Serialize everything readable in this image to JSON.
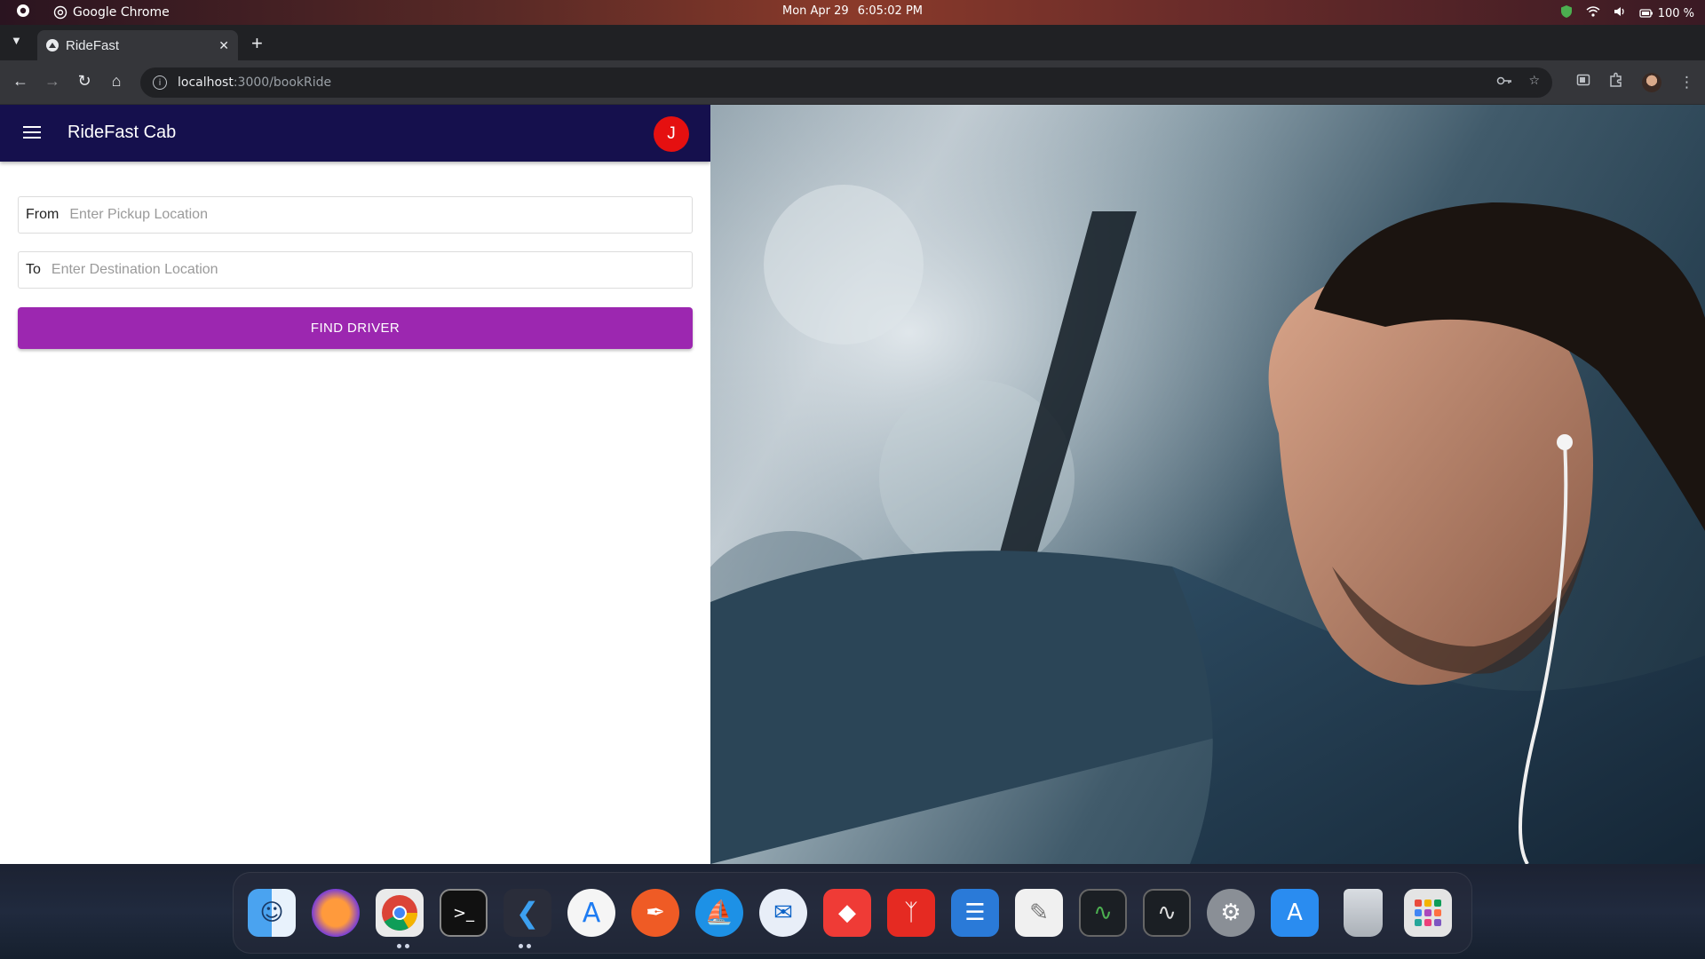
{
  "os_bar": {
    "app_name": "Google Chrome",
    "date": "Mon Apr 29",
    "time": "6:05:02 PM",
    "battery": "100 %"
  },
  "browser": {
    "tab_title": "RideFast",
    "url_host": "localhost",
    "url_path": ":3000/bookRide"
  },
  "app": {
    "title": "RideFast Cab",
    "avatar_initial": "J",
    "from_label": "From",
    "from_placeholder": "Enter Pickup Location",
    "from_value": "",
    "to_label": "To",
    "to_placeholder": "Enter Destination Location",
    "to_value": "",
    "find_driver_label": "FIND DRIVER"
  },
  "colors": {
    "app_bar": "#15104d",
    "button": "#9c27b0",
    "avatar": "#e51010"
  },
  "dock": {
    "icons": [
      "finder-icon",
      "firefox-icon",
      "chrome-icon",
      "terminal-icon",
      "vscode-icon",
      "app-store-icon",
      "postman-icon",
      "docker-icon",
      "thunderbird-icon",
      "anydesk-icon",
      "acrobat-icon",
      "text-editor-icon",
      "notes-icon",
      "activity-monitor-icon",
      "system-monitor-icon",
      "settings-icon",
      "software-updater-icon",
      "trash-icon",
      "app-grid-icon"
    ]
  }
}
